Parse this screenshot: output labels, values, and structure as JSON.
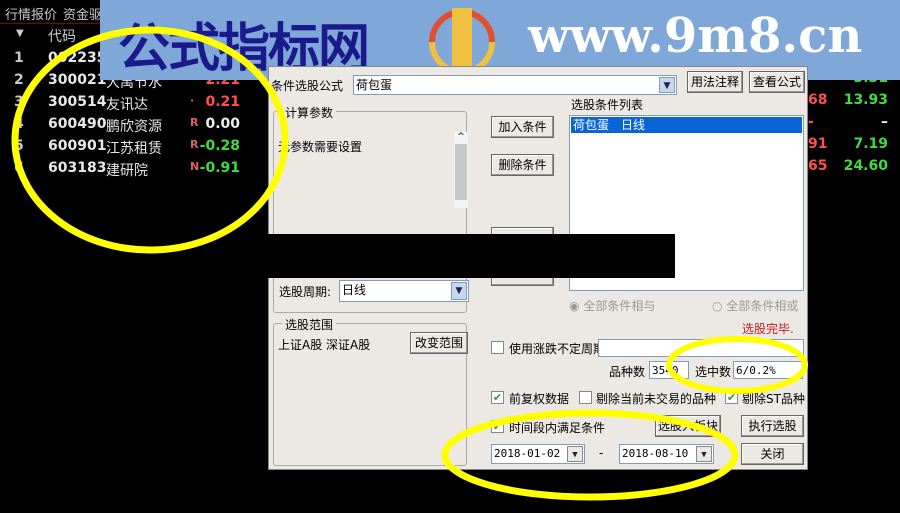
{
  "tabs": [
    "行情报价",
    "资金驱"
  ],
  "table": {
    "header_code": "代码",
    "rows": [
      {
        "idx": "1",
        "code": "002235",
        "name": "",
        "flag": "",
        "value": "",
        "color": "white"
      },
      {
        "idx": "2",
        "code": "300021",
        "name": "大禹节水",
        "flag": "",
        "value": "2.21",
        "color": "red"
      },
      {
        "idx": "3",
        "code": "300514",
        "name": "友讯达",
        "flag": "·",
        "value": "0.21",
        "color": "red"
      },
      {
        "idx": "4",
        "code": "600490",
        "name": "鹏欣资源",
        "flag": "R",
        "value": "0.00",
        "color": "white"
      },
      {
        "idx": "5",
        "code": "600901",
        "name": "江苏租赁",
        "flag": "R",
        "value": "-0.28",
        "color": "green"
      },
      {
        "idx": "6",
        "code": "603183",
        "name": "建研院",
        "flag": "N",
        "value": "-0.91",
        "color": "green"
      }
    ],
    "right_col": [
      {
        "partial": "",
        "value": "3.31"
      },
      {
        "partial": "68",
        "value": "13.93"
      },
      {
        "partial": "-",
        "value": "–"
      },
      {
        "partial": "91",
        "value": "7.19"
      },
      {
        "partial": "65",
        "value": "24.60"
      }
    ]
  },
  "banner": {
    "title": "公式指标网",
    "url": "www.9m8.cn",
    "logo_text": "www.9m8.cn"
  },
  "dialog": {
    "formula_label": "条件选股公式",
    "formula_value": "荷包蛋",
    "usage_button": "用法注释",
    "view_formula_button": "查看公式",
    "params_group": "计算参数",
    "params_text": "无参数需要设置",
    "add_condition": "加入条件",
    "delete_condition": "删除条件",
    "period_label": "选股周期:",
    "period_value": "日线",
    "condition_list_label": "选股条件列表",
    "condition_items": [
      "荷包蛋　日线"
    ],
    "radio_and": "全部条件相与",
    "radio_or": "全部条件相或",
    "status": "选股完毕.",
    "range_group": "选股范围",
    "range_text": "上证A股 深证A股",
    "change_range": "改变范围",
    "use_period_label": "使用涨跌不定周期",
    "count_label": "品种数",
    "count_value": "3540",
    "selected_label": "选中数",
    "selected_value": "6/0.2%",
    "fq_label": "前复权数据",
    "exclude_untraded_label": "剔除当前未交易的品种",
    "exclude_st_label": "剔除ST品种",
    "time_range_label": "时间段内满足条件",
    "to_block_button": "选股入板块",
    "execute_button": "执行选股",
    "start_date": "2018-01-02",
    "dash": "-",
    "end_date": "2018-08-10",
    "close_button": "关闭"
  },
  "colors": {
    "highlight": "#ffff00",
    "banner": "#7fa8d8",
    "select": "#0a64d6"
  }
}
